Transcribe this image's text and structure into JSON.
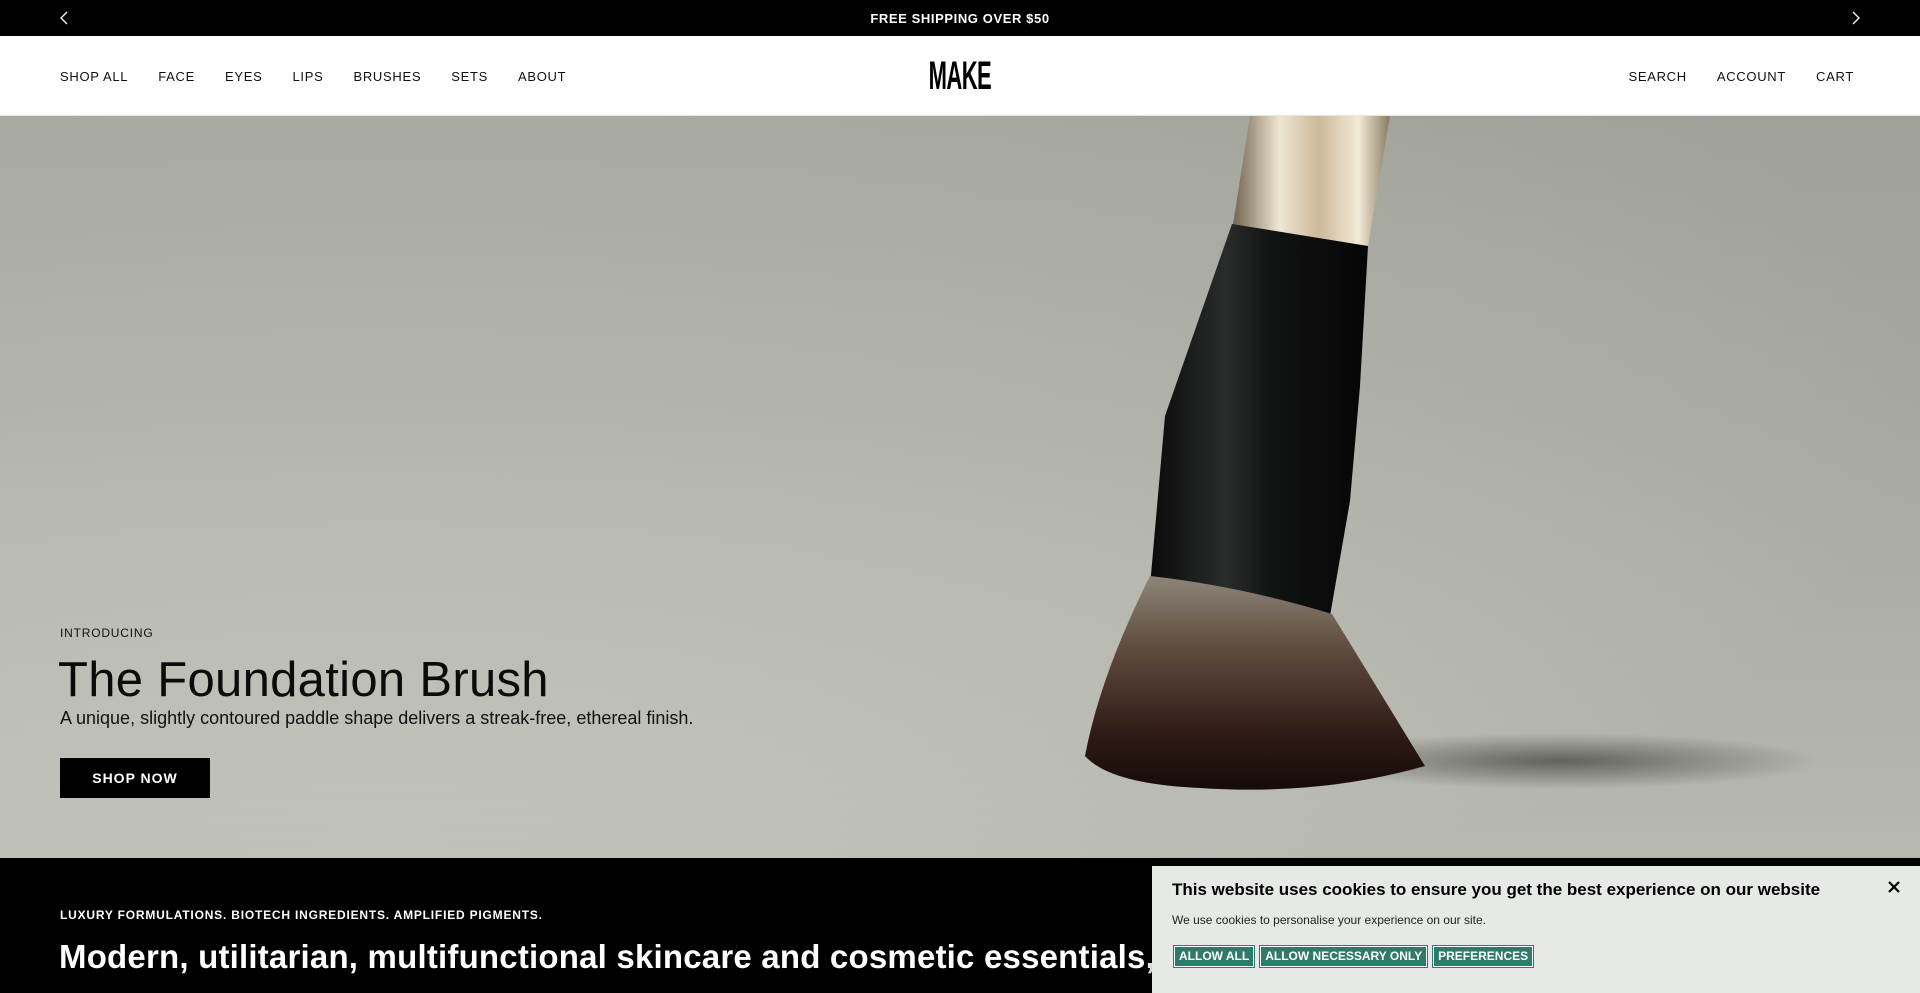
{
  "announcement": {
    "text": "FREE SHIPPING OVER $50",
    "prev_icon": "chevron-left-icon",
    "next_icon": "chevron-right-icon"
  },
  "header": {
    "logo": "MAKE",
    "nav_left": [
      "SHOP ALL",
      "FACE",
      "EYES",
      "LIPS",
      "BRUSHES",
      "SETS",
      "ABOUT"
    ],
    "nav_right": [
      "SEARCH",
      "ACCOUNT",
      "CART"
    ]
  },
  "hero": {
    "eyebrow": "INTRODUCING",
    "title": "The Foundation Brush",
    "subtitle": "A unique, slightly contoured paddle shape delivers a streak-free, ethereal finish.",
    "cta": "SHOP NOW"
  },
  "band": {
    "eyebrow": "LUXURY FORMULATIONS. BIOTECH INGREDIENTS. AMPLIFIED PIGMENTS.",
    "heading": "Modern, utilitarian, multifunctional skincare and cosmetic essentials, designed"
  },
  "cookie": {
    "title": "This website uses cookies to ensure you get the best experience on our website",
    "text": "We use cookies to personalise your experience on our site.",
    "buttons": [
      "ALLOW ALL",
      "ALLOW NECESSARY ONLY",
      "PREFERENCES"
    ],
    "close_icon": "close-icon",
    "button_color": "#2f7a6b"
  },
  "colors": {
    "announcement_bg": "#000000",
    "hero_bg": "#b3b4ac",
    "band_bg": "#000000",
    "cookie_bg": "#e6e9e6"
  }
}
